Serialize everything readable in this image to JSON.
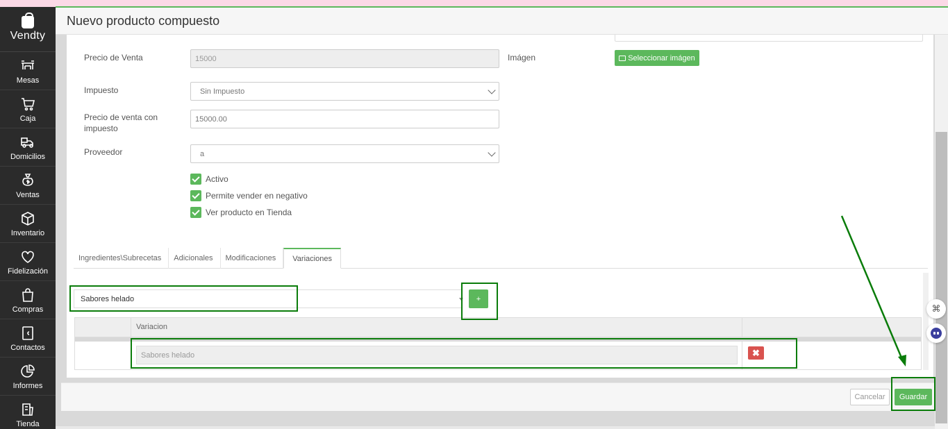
{
  "app": {
    "brand": "Vendty"
  },
  "sidebar": {
    "items": [
      {
        "label": "Mesas",
        "icon": "tables-icon"
      },
      {
        "label": "Caja",
        "icon": "cart-icon"
      },
      {
        "label": "Domicilios",
        "icon": "delivery-icon"
      },
      {
        "label": "Ventas",
        "icon": "money-bag-icon"
      },
      {
        "label": "Inventario",
        "icon": "box-icon"
      },
      {
        "label": "Fidelización",
        "icon": "heart-icon"
      },
      {
        "label": "Compras",
        "icon": "shopping-bag-icon"
      },
      {
        "label": "Contactos",
        "icon": "contacts-icon"
      },
      {
        "label": "Informes",
        "icon": "pie-chart-icon"
      },
      {
        "label": "Tienda",
        "icon": "store-icon"
      }
    ]
  },
  "header": {
    "title": "Nuevo producto compuesto"
  },
  "form": {
    "precio_venta": {
      "label": "Precio de Venta",
      "value": "15000"
    },
    "imagen": {
      "label": "Imágen",
      "button": "Seleccionar imágen"
    },
    "impuesto": {
      "label": "Impuesto",
      "value": "Sin Impuesto"
    },
    "precio_con_impuesto": {
      "label": "Precio de venta con impuesto",
      "value": "15000.00"
    },
    "proveedor": {
      "label": "Proveedor",
      "value": "a"
    },
    "checks": {
      "activo": "Activo",
      "negativo": "Permite vender en negativo",
      "tienda": "Ver producto en Tienda"
    }
  },
  "tabs": [
    "Ingredientes\\Subrecetas",
    "Adicionales",
    "Modificaciones",
    "Variaciones"
  ],
  "variaciones": {
    "select_value": "Sabores helado",
    "add_label": "+",
    "table_header": "Variacion",
    "row_value": "Sabores helado",
    "delete_label": "✖"
  },
  "footer": {
    "cancel": "Cancelar",
    "save": "Guardar"
  },
  "colors": {
    "primary": "#5cb85c",
    "danger": "#d9534f",
    "sidebar": "#2b2b2b",
    "annotation": "#0a7c0a"
  }
}
